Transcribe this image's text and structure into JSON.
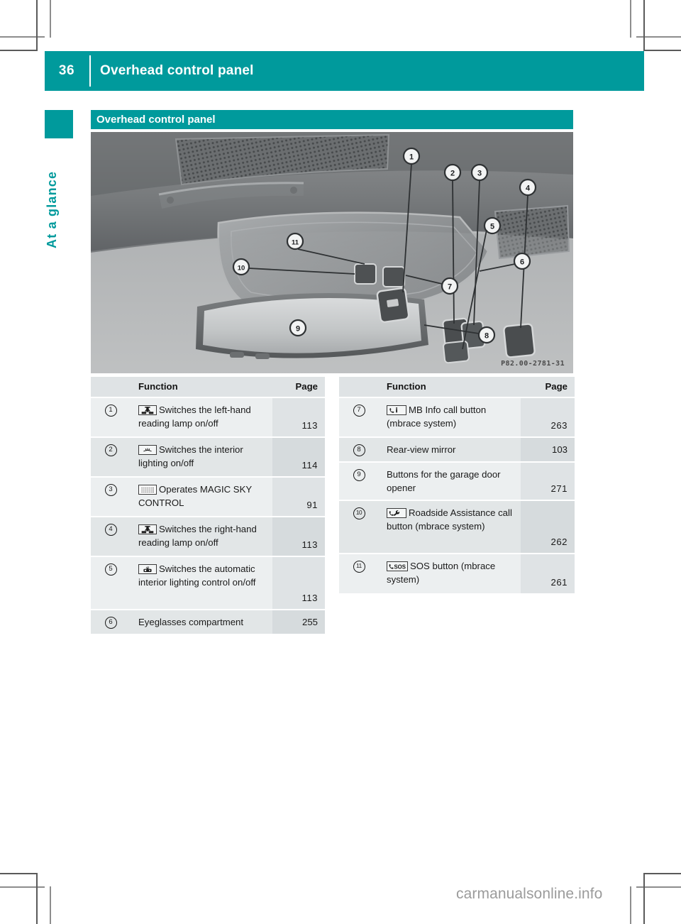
{
  "colors": {
    "teal": "#009a9c",
    "header_text": "#ffffff",
    "table_header_bg": "#dfe3e5",
    "row_light": "#eceff0",
    "row_dark": "#e2e6e7",
    "page_col_light": "#dfe3e5",
    "page_col_dark": "#d6dbdd",
    "body_text": "#1a1a1a",
    "watermark": "#9b9b9b"
  },
  "header": {
    "page_number": "36",
    "title": "Overhead control panel"
  },
  "chapter_tab": {
    "label": "At a glance"
  },
  "section": {
    "heading": "Overhead control panel"
  },
  "figure": {
    "code": "P82.00-2781-31",
    "alt": "Overhead control panel of the vehicle with callouts 1 through 11",
    "callouts": [
      "1",
      "2",
      "3",
      "4",
      "5",
      "6",
      "7",
      "8",
      "9",
      "10",
      "11"
    ]
  },
  "tables": [
    {
      "id": "table-left",
      "columns": [
        "",
        "Function",
        "Page"
      ],
      "rows": [
        {
          "num": "1",
          "icon": "reading-lamp-icon",
          "text": "Switches the left-hand reading lamp on/off",
          "page": "113"
        },
        {
          "num": "2",
          "icon": "interior-lighting-icon",
          "text": "Switches the interior lighting on/off",
          "page": "114"
        },
        {
          "num": "3",
          "icon": "magic-sky-control-icon",
          "text": "Operates MAGIC SKY CONTROL",
          "page": "91"
        },
        {
          "num": "4",
          "icon": "reading-lamp-icon",
          "text": "Switches the right-hand reading lamp on/off",
          "page": "113"
        },
        {
          "num": "5",
          "icon": "automatic-interior-lighting-icon",
          "text": "Switches the automatic interior lighting control on/off",
          "page": "113"
        },
        {
          "num": "6",
          "icon": null,
          "text": "Eyeglasses compartment",
          "page": "255"
        }
      ]
    },
    {
      "id": "table-right",
      "columns": [
        "",
        "Function",
        "Page"
      ],
      "rows": [
        {
          "num": "7",
          "icon": "mb-info-call-icon",
          "text": "MB Info call button (mbrace system)",
          "page": "263"
        },
        {
          "num": "8",
          "icon": null,
          "text": "Rear-view mirror",
          "page": "103"
        },
        {
          "num": "9",
          "icon": null,
          "text": "Buttons for the garage door opener",
          "page": "271"
        },
        {
          "num": "10",
          "icon": "roadside-assistance-icon",
          "text": "Roadside Assistance call button (mbrace system)",
          "page": "262"
        },
        {
          "num": "11",
          "icon": "sos-call-icon",
          "text": "SOS button (mbrace system)",
          "page": "261"
        }
      ]
    }
  ],
  "watermark": {
    "text": "carmanualsonline.info"
  }
}
